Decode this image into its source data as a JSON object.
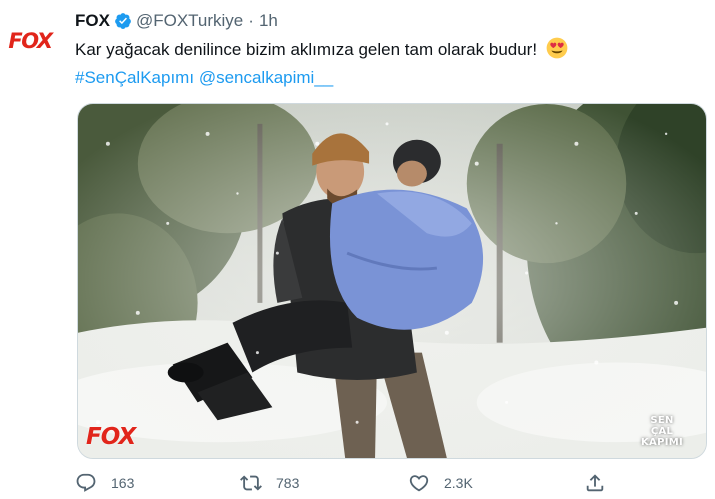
{
  "tweet": {
    "author": {
      "avatar_text": "FOX",
      "display_name": "FOX",
      "verified": true,
      "handle": "@FOXTurkiye",
      "separator": "·",
      "time": "1h"
    },
    "text": "Kar yağacak denilince bizim aklımıza gelen tam olarak budur!",
    "emoji": "smiling-face-with-heart-eyes",
    "hashtag": "#SenÇalKapımı",
    "mention": "@sencalkapimi__",
    "media": {
      "watermark_left": "FOX",
      "watermark_right": [
        "SEN",
        "ÇAL",
        "KAPIMI"
      ]
    },
    "actions": {
      "reply_count": "163",
      "retweet_count": "783",
      "like_count": "2.3K"
    }
  },
  "colors": {
    "link": "#1d9bf0",
    "secondary_text": "#536471",
    "brand_red": "#e1251b",
    "verified": "#1d9bf0"
  }
}
